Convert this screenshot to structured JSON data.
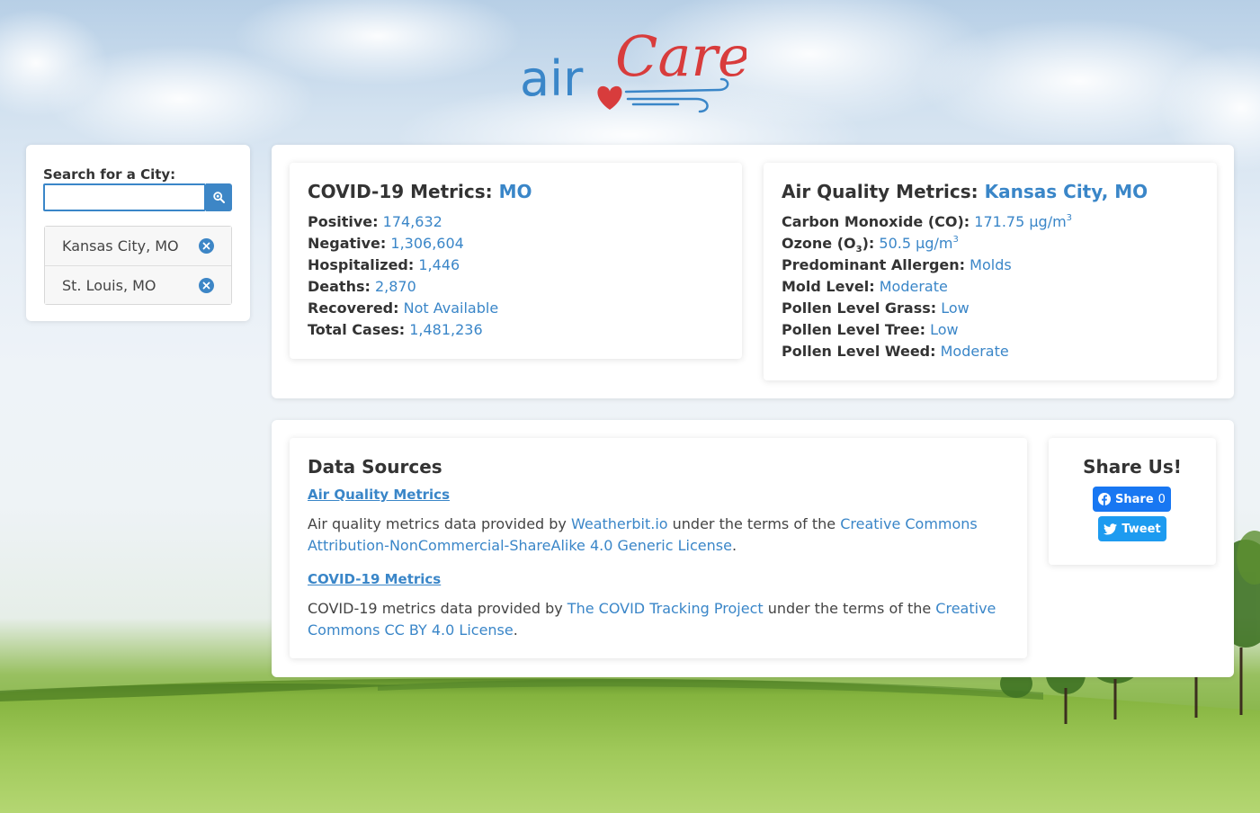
{
  "logo": {
    "text_air": "air",
    "text_care": "Care"
  },
  "search": {
    "label": "Search for a City:",
    "value": "",
    "placeholder": "",
    "cities": [
      {
        "name": "Kansas City, MO"
      },
      {
        "name": "St. Louis, MO"
      }
    ]
  },
  "covid": {
    "title": "COVID-19 Metrics:",
    "state": "MO",
    "metrics": [
      {
        "label": "Positive:",
        "value": "174,632"
      },
      {
        "label": "Negative:",
        "value": "1,306,604"
      },
      {
        "label": "Hospitalized:",
        "value": "1,446"
      },
      {
        "label": "Deaths:",
        "value": "2,870"
      },
      {
        "label": "Recovered:",
        "value": "Not Available"
      },
      {
        "label": "Total Cases:",
        "value": "1,481,236"
      }
    ]
  },
  "air_quality": {
    "title": "Air Quality Metrics:",
    "city": "Kansas City, MO",
    "co": {
      "label": "Carbon Monoxide (CO):",
      "value": "171.75 µg/m",
      "unit_exp": "3"
    },
    "ozone": {
      "label_prefix": "Ozone (O",
      "label_sub": "3",
      "label_suffix": "):",
      "value": "50.5 µg/m",
      "unit_exp": "3"
    },
    "metrics": [
      {
        "label": "Predominant Allergen:",
        "value": "Molds"
      },
      {
        "label": "Mold Level:",
        "value": "Moderate"
      },
      {
        "label": "Pollen Level Grass:",
        "value": "Low"
      },
      {
        "label": "Pollen Level Tree:",
        "value": "Low"
      },
      {
        "label": "Pollen Level Weed:",
        "value": "Moderate"
      }
    ]
  },
  "data_sources": {
    "title": "Data Sources",
    "aq": {
      "heading": "Air Quality Metrics",
      "text1": "Air quality metrics data provided by ",
      "link1": "Weatherbit.io",
      "text2": " under the terms of the ",
      "link2": "Creative Commons Attribution-NonCommercial-ShareAlike 4.0 Generic License",
      "text3": "."
    },
    "covid": {
      "heading": "COVID-19 Metrics",
      "text1": "COVID-19 metrics data provided by ",
      "link1": "The COVID Tracking Project",
      "text2": " under the terms of the ",
      "link2": "Creative Commons CC BY 4.0 License",
      "text3": "."
    }
  },
  "share": {
    "title": "Share Us!",
    "facebook_label": "Share",
    "facebook_count": "0",
    "twitter_label": "Tweet"
  },
  "colors": {
    "accent": "#3a86c8",
    "logo_blue": "#3a86c8",
    "logo_red": "#d83c3c",
    "facebook": "#1877f2",
    "twitter": "#1d9bf0"
  }
}
